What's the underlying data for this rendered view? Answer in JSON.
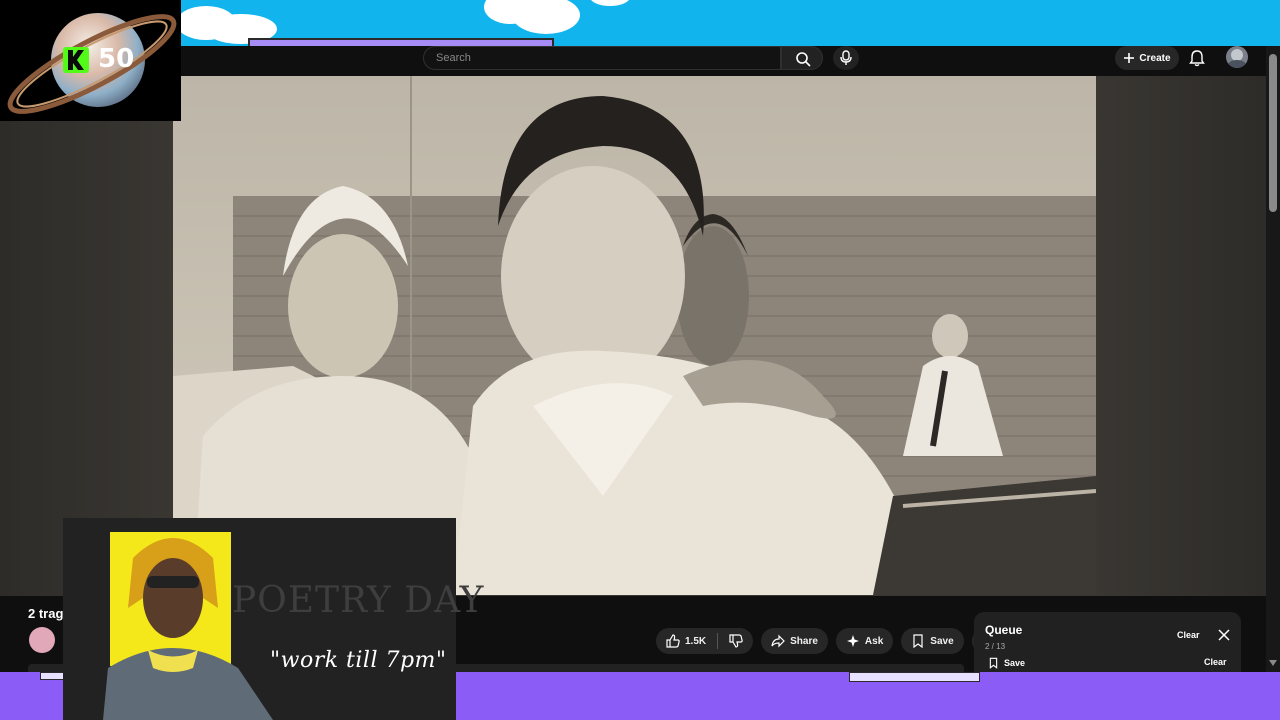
{
  "overlay": {
    "kick_count": "50",
    "cam_sign": "POETRY DAY",
    "cam_caption": "\"work till 7pm\""
  },
  "masthead": {
    "search_placeholder": "Search",
    "create_label": "Create"
  },
  "video": {
    "title_fragment": "2 trag"
  },
  "actions": {
    "like_count": "1.5K",
    "share_label": "Share",
    "ask_label": "Ask",
    "save_label": "Save"
  },
  "queue": {
    "title": "Queue",
    "count": "2 / 13",
    "clear_label": "Clear",
    "save_label": "Save",
    "clear2_label": "Clear"
  },
  "colors": {
    "sky": "#12b4ee",
    "band": "#8b5cf6",
    "kick_green": "#53fc18"
  }
}
